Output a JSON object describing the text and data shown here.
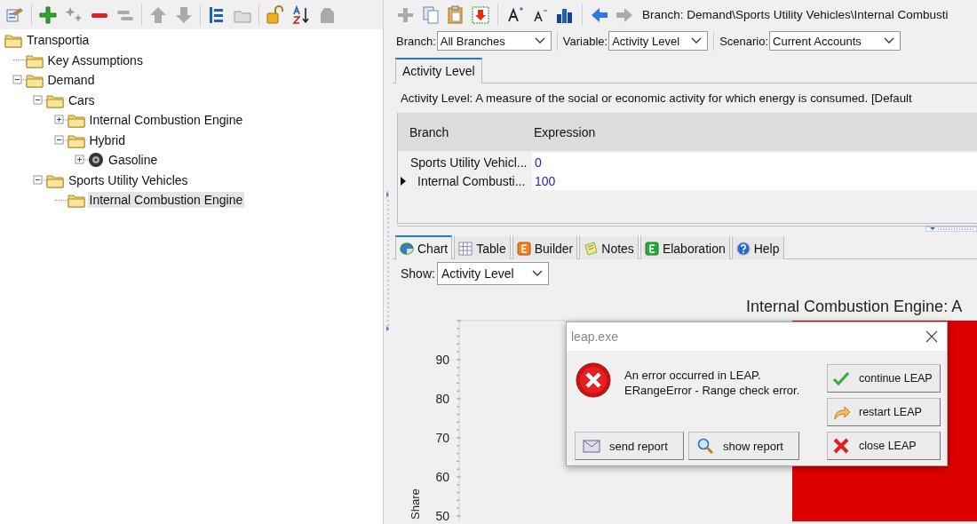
{
  "tree": {
    "items": [
      {
        "label": "Transportia",
        "kind": "folder",
        "selected": false,
        "children": [
          {
            "label": "Key Assumptions",
            "kind": "folder",
            "selected": false
          },
          {
            "label": "Demand",
            "kind": "folder",
            "expanded": true,
            "selected": false,
            "children": [
              {
                "label": "Cars",
                "kind": "folder",
                "expanded": true,
                "selected": false,
                "children": [
                  {
                    "label": "Internal Combustion Engine",
                    "kind": "folder",
                    "expanded": false,
                    "selected": false
                  },
                  {
                    "label": "Hybrid",
                    "kind": "folder",
                    "expanded": true,
                    "selected": false,
                    "children": [
                      {
                        "label": "Gasoline",
                        "kind": "fuel",
                        "expanded": false,
                        "selected": false
                      }
                    ]
                  }
                ]
              },
              {
                "label": "Sports Utility Vehicles",
                "kind": "folder",
                "expanded": true,
                "selected": false,
                "children": [
                  {
                    "label": "Internal Combustion Engine",
                    "kind": "folder",
                    "selected": true
                  }
                ]
              }
            ]
          }
        ]
      }
    ]
  },
  "editor": {
    "breadcrumb": "Branch: Demand\\Sports Utility Vehicles\\Internal Combusti",
    "filters": [
      {
        "label": "Branch:",
        "value": "All Branches"
      },
      {
        "label": "Variable:",
        "value": "Activity Level"
      },
      {
        "label": "Scenario:",
        "value": "Current Accounts"
      }
    ],
    "tabs": [
      {
        "label": "Activity Level",
        "selected": true
      }
    ],
    "description": "Activity Level: A measure of the social or economic activity for which energy is consumed. [Default",
    "grid": {
      "columns": [
        "Branch",
        "Expression"
      ],
      "rows": [
        {
          "branch": "Sports Utility Vehicl...",
          "expression": "0",
          "current": false,
          "indent": false
        },
        {
          "branch": "Internal Combusti...",
          "expression": "100",
          "current": true,
          "indent": true
        }
      ]
    }
  },
  "bottom_tabs": [
    {
      "label": "Chart",
      "selected": true
    },
    {
      "label": "Table",
      "selected": false
    },
    {
      "label": "Builder",
      "selected": false
    },
    {
      "label": "Notes",
      "selected": false
    },
    {
      "label": "Elaboration",
      "selected": false
    },
    {
      "label": "Help",
      "selected": false
    }
  ],
  "show": {
    "label": "Show:",
    "value": "Activity Level"
  },
  "chart": {
    "title": "Internal Combustion Engine: A",
    "y_axis_label": "Share",
    "y_ticks": [
      "90",
      "80",
      "70",
      "60",
      "50"
    ]
  },
  "dialog": {
    "title": "leap.exe",
    "message": [
      "An error occurred in LEAP.",
      "ERangeError - Range check error."
    ],
    "buttons": [
      {
        "label": "continue LEAP",
        "kind": "side"
      },
      {
        "label": "restart LEAP",
        "kind": "side"
      },
      {
        "label": "send report",
        "kind": "bottom"
      },
      {
        "label": "show report",
        "kind": "bottom"
      },
      {
        "label": "close LEAP",
        "kind": "side"
      }
    ]
  }
}
